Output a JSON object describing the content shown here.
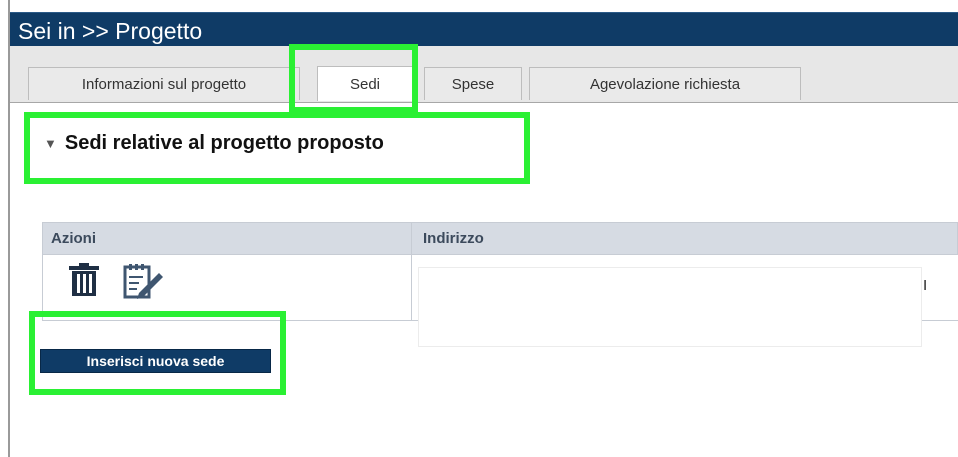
{
  "header": {
    "title": "Sei in >> Progetto"
  },
  "tabs": [
    {
      "label": "Informazioni sul progetto",
      "active": false
    },
    {
      "label": "Sedi",
      "active": true
    },
    {
      "label": "Spese",
      "active": false
    },
    {
      "label": "Agevolazione richiesta",
      "active": false
    }
  ],
  "section": {
    "title": "Sedi relative al progetto proposto",
    "collapsed": false
  },
  "table": {
    "columns": [
      "Azioni",
      "Indirizzo"
    ],
    "rows": [
      {
        "actions": [
          "trash-icon",
          "edit-icon"
        ],
        "address_visible_fragment": "I"
      }
    ]
  },
  "buttons": {
    "add_label": "Inserisci nuova sede"
  },
  "colors": {
    "header_bg": "#0f3b66",
    "highlight": "#2af033",
    "table_header_bg": "#d6dbe3",
    "button_bg": "#0f3b66"
  }
}
